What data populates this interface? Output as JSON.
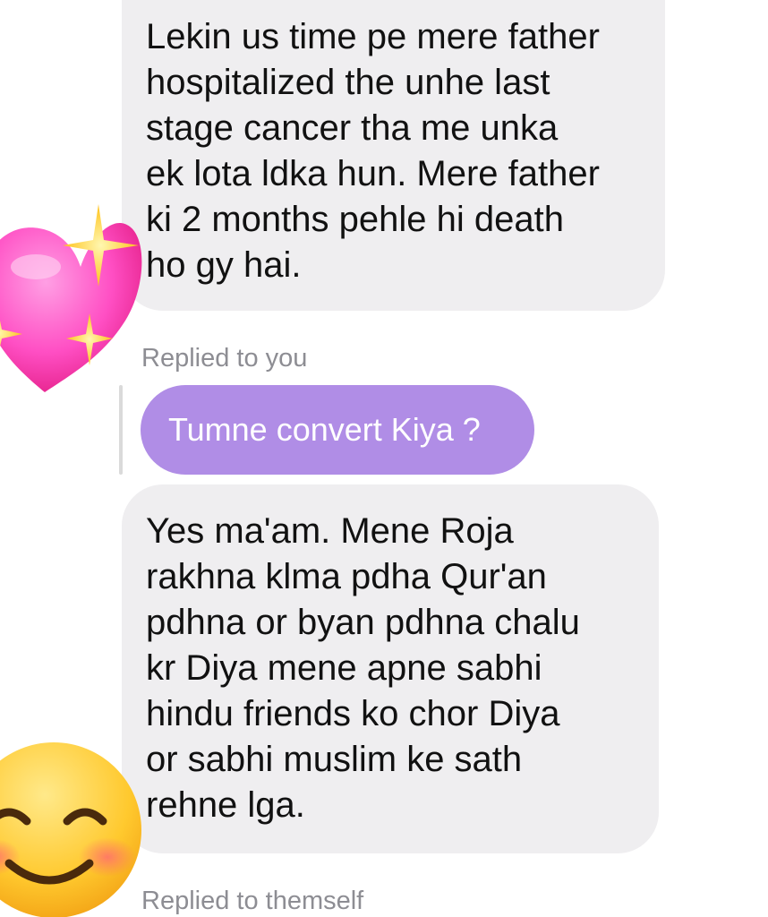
{
  "messages": [
    {
      "id": "msg1",
      "text": "Lekin us time pe mere father\nhospitalized the unhe last\nstage cancer tha me unka\nek lota ldka hun. Mere father\nki 2 months pehle hi death\nho gy hai."
    },
    {
      "id": "msg3",
      "text": "Yes ma'am. Mene Roja\nrakhna klma pdha Qur'an\npdhna or byan pdhna chalu\nkr Diya mene apne sabhi\nhindu friends ko chor Diya\nor sabhi muslim ke sath\nrehne lga."
    }
  ],
  "reply_labels": {
    "first": "Replied to you",
    "second": "Replied to themself"
  },
  "quoted_message": {
    "text": "Tumne convert Kiya ?"
  },
  "reactions": {
    "first": "sparkling-heart",
    "second": "smiling-face-with-smiling-eyes"
  },
  "colors": {
    "incoming_bubble": "#efeef0",
    "quoted_bubble": "#b08de6",
    "label_text": "#8d8d93"
  }
}
